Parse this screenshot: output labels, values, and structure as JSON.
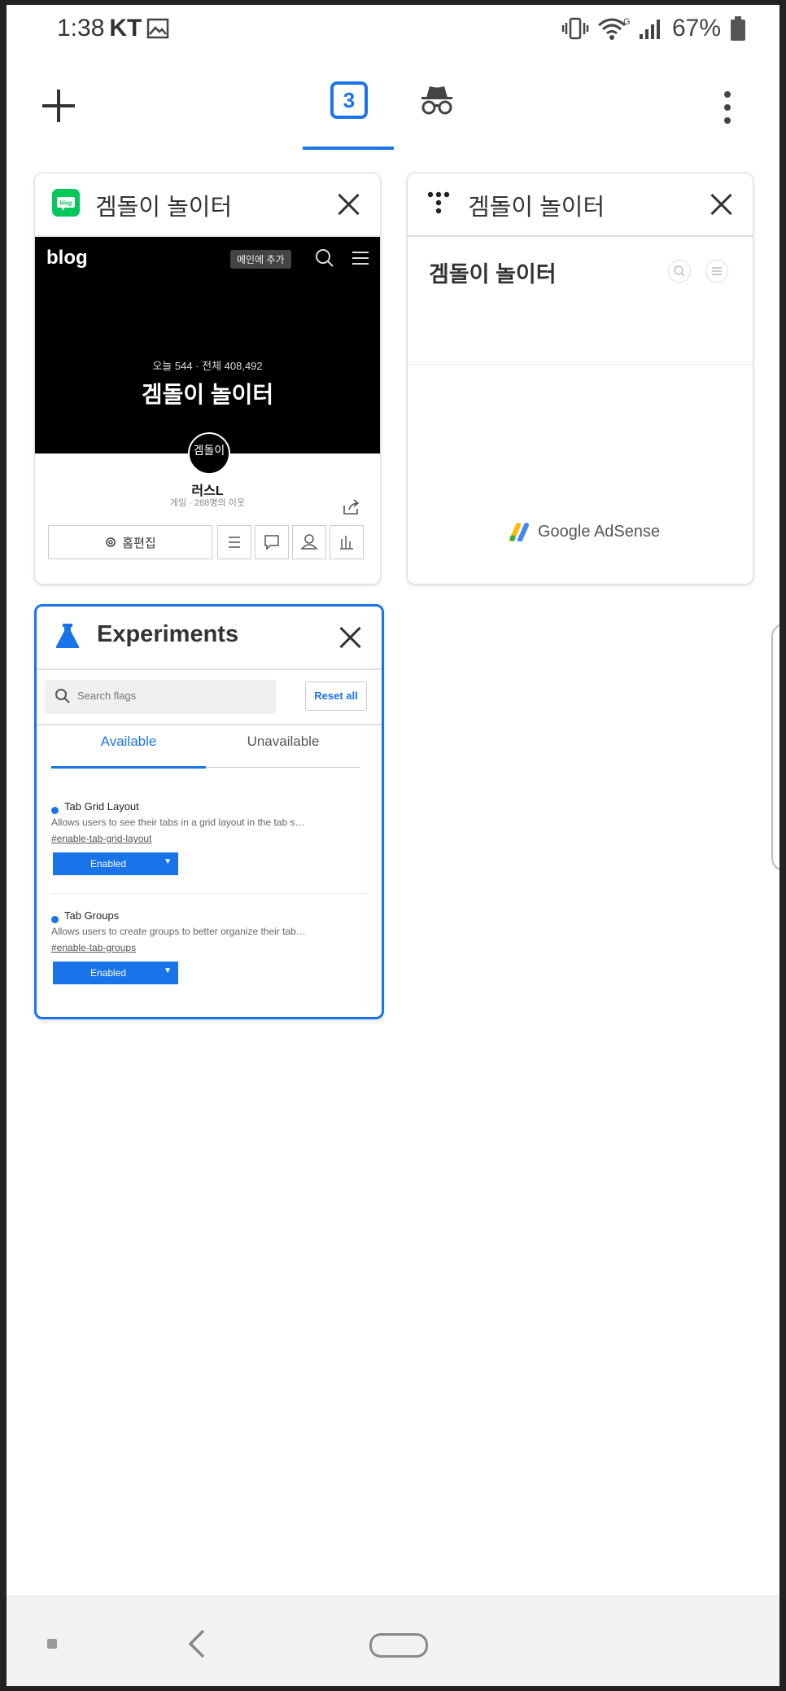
{
  "status_bar": {
    "time": "1:38",
    "carrier": "KT",
    "battery": "67%"
  },
  "toolbar": {
    "tab_count": "3",
    "icons": [
      "plus-icon",
      "incognito-icon",
      "more-vert-icon"
    ]
  },
  "tabs": [
    {
      "title": "겜돌이 놀이터",
      "favicon": "naver-blog-icon",
      "preview": {
        "logo": "blog",
        "add_button": "메인에 추가",
        "stats": "오늘 544 · 전체 408,492",
        "blog_name": "겜돌이 놀이터",
        "avatar_text": "겜돌이",
        "user": "러스L",
        "subtitle": "게임 · 288명의 이웃",
        "edit_button": "홈편집"
      }
    },
    {
      "title": "겜돌이 놀이터",
      "favicon": "tistory-icon",
      "preview": {
        "blog_name": "겜돌이 놀이터",
        "ad_label": "Google AdSense"
      }
    },
    {
      "title": "Experiments",
      "favicon": "flask-icon",
      "selected": true,
      "preview": {
        "search_placeholder": "Search flags",
        "reset_button": "Reset all",
        "tab_available": "Available",
        "tab_unavailable": "Unavailable",
        "flags": [
          {
            "name": "Tab Grid Layout",
            "description": "Allows users to see their tabs in a grid layout in the tab s…",
            "link": "#enable-tab-grid-layout",
            "value": "Enabled"
          },
          {
            "name": "Tab Groups",
            "description": "Allows users to create groups to better organize their tab…",
            "link": "#enable-tab-groups",
            "value": "Enabled"
          }
        ]
      }
    }
  ],
  "colors": {
    "accent": "#1a73e8",
    "naver_green": "#03c75a"
  }
}
